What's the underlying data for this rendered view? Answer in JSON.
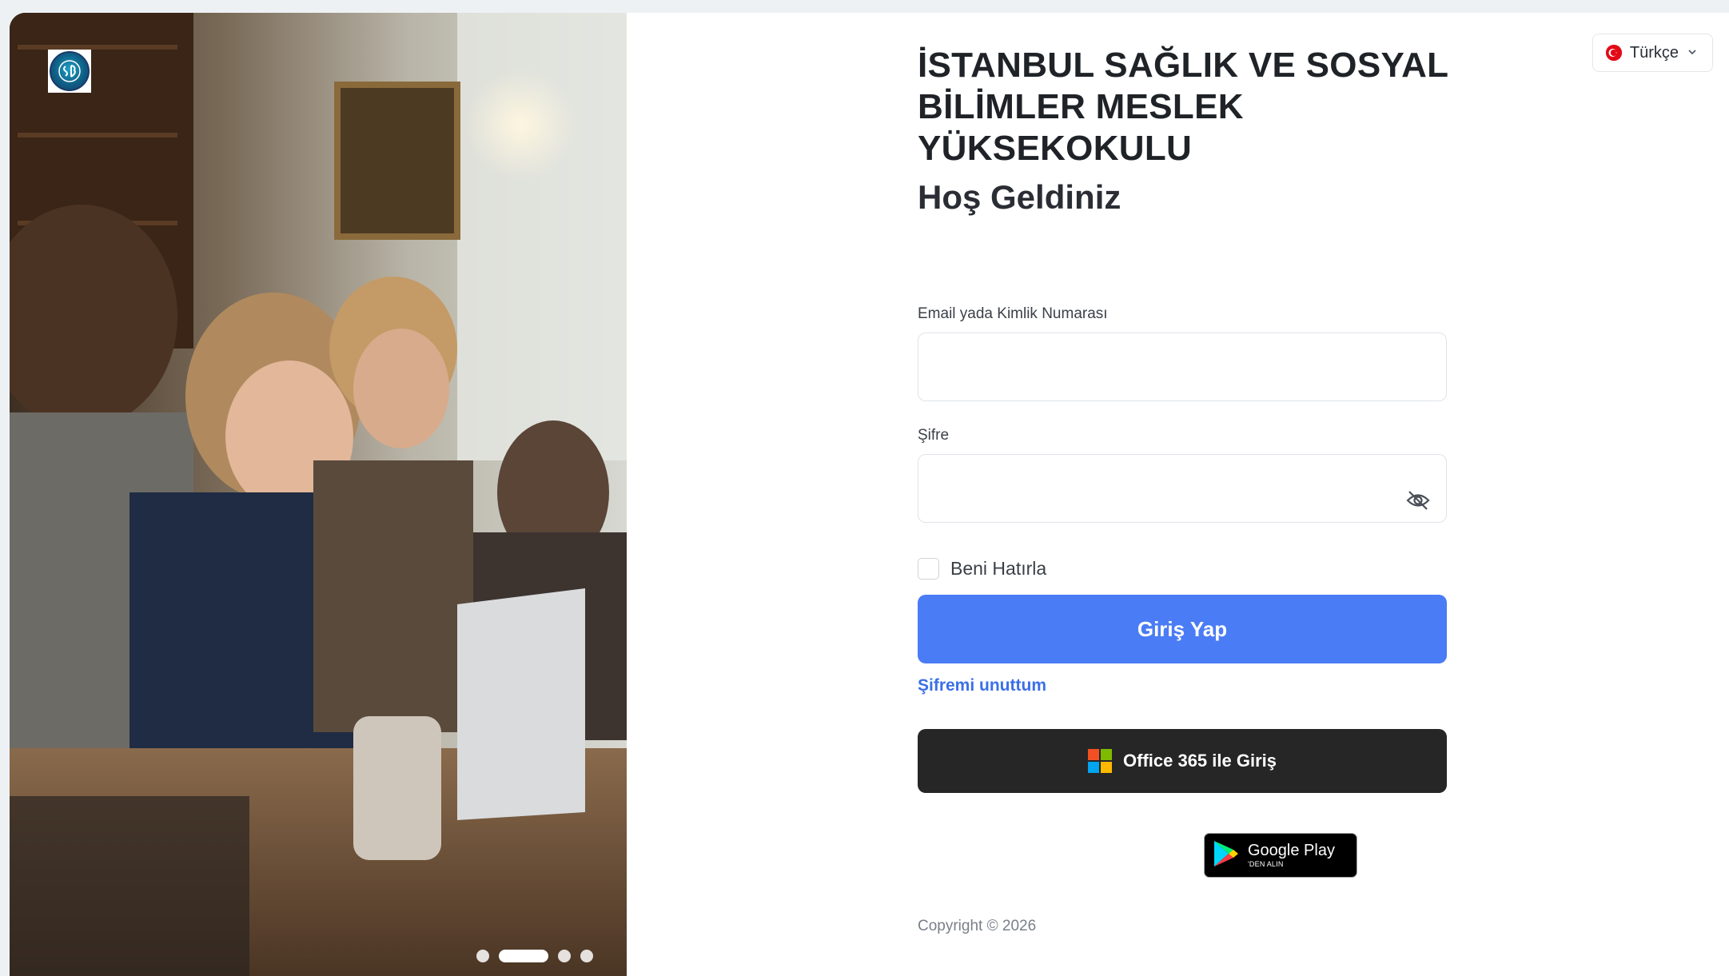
{
  "language": {
    "selected": "Türkçe"
  },
  "header": {
    "institution_name": "İSTANBUL SAĞLIK VE SOSYAL BİLİMLER MESLEK YÜKSEKOKULU",
    "welcome": "Hoş Geldiniz"
  },
  "form": {
    "email_label": "Email yada Kimlik Numarası",
    "email_value": "",
    "password_label": "Şifre",
    "password_value": "",
    "remember_label": "Beni Hatırla",
    "login_button": "Giriş Yap",
    "forgot_link": "Şifremi unuttum",
    "office_button": "Office 365 ile Giriş"
  },
  "google_play": {
    "title": "Google Play",
    "subtitle": "'DEN ALIN"
  },
  "footer": {
    "copyright": "Copyright © 2026"
  },
  "carousel": {
    "slide_count": 4,
    "active_index": 1
  },
  "colors": {
    "primary": "#4a7cf5",
    "link": "#3b6fe8",
    "office_button": "#262626"
  },
  "icons": {
    "password_toggle": "eye-off-icon",
    "language_flag": "turkey-flag-icon",
    "dropdown": "chevron-down-icon",
    "office": "microsoft-logo-icon",
    "store": "google-play-icon"
  }
}
